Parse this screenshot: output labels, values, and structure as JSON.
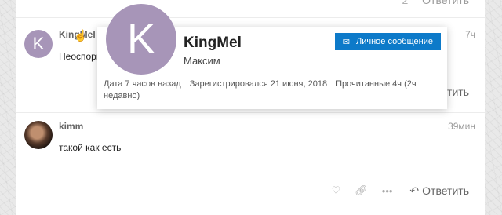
{
  "top_actions": {
    "like_count": "2",
    "reply_label": "Ответить"
  },
  "posts": [
    {
      "avatar_letter": "K",
      "username": "KingMel",
      "time": "7ч",
      "text": "Неоспори",
      "reply_label": "Ответить"
    },
    {
      "username": "kimm",
      "time": "39мин",
      "text": "такой как есть",
      "reply_label": "Ответить"
    }
  ],
  "user_card": {
    "avatar_letter": "K",
    "username": "KingMel",
    "full_name": "Максим",
    "message_button": "Личное сообщение",
    "posted": "Дата 7 часов назад",
    "registered": "Зарегистрировался 21 июня, 2018",
    "read": "Прочитанные 4ч (2ч недавно)"
  },
  "icons": {
    "avatar_color": "#a795b8",
    "message_button_color": "#0d7ac9",
    "cursor": "hand-pointer-icon"
  }
}
